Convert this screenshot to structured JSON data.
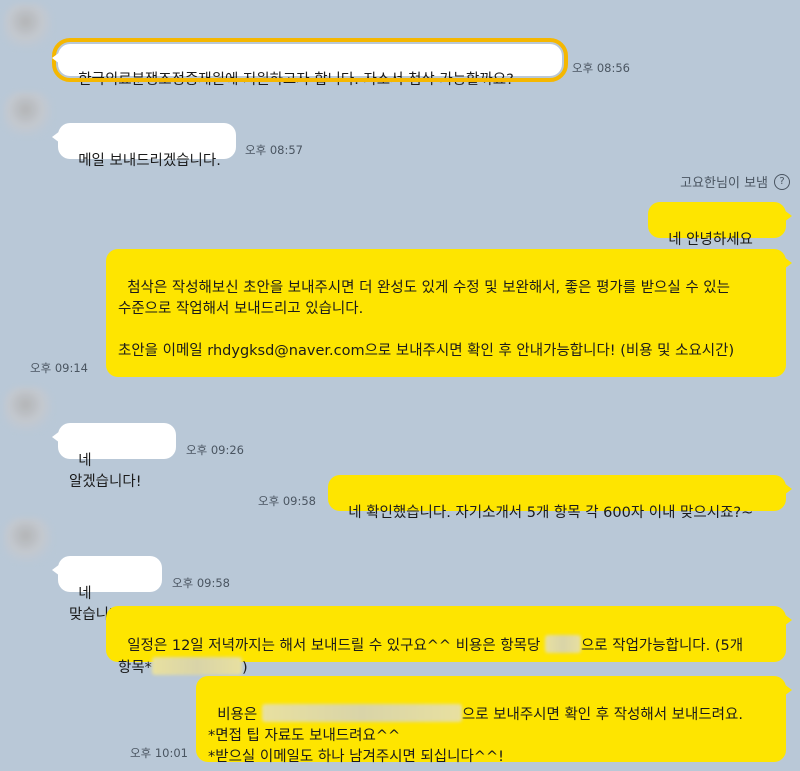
{
  "chat": {
    "m1": {
      "text": "한국의료분쟁조정중재원에 지원하고자 합니다. 자소서 첨삭 가능할까요?",
      "time": "오후 08:56"
    },
    "m2": {
      "text": "메일 보내드리겠습니다.",
      "time": "오후 08:57"
    },
    "sender_note": "고요한님이 보냄",
    "m3": {
      "text": "네 안녕하세요^^"
    },
    "m4": {
      "text": "첨삭은 작성해보신 초안을 보내주시면 더 완성도 있게 수정 및 보완해서, 좋은 평가를 받으실 수 있는 수준으로 작업해서 보내드리고 있습니다.\n\n초안을 이메일 rhdygksd@naver.com으로 보내주시면 확인 후 안내가능합니다! (비용 및 소요시간)",
      "time": "오후 09:14"
    },
    "m5": {
      "text": "네 알겠습니다!",
      "time": "오후 09:26"
    },
    "m6": {
      "text": "네 확인했습니다. 자기소개서 5개 항목 각 600자 이내 맞으시죠?~",
      "time": "오후 09:58"
    },
    "m7": {
      "text": "네 맞습니다!",
      "time": "오후 09:58"
    },
    "m8": {
      "part1": "일정은 12일 저녁까지는 해서 보내드릴 수 있구요^^ 비용은 항목당 ",
      "part2": "으로 작업가능합니다. (5개 항목*",
      "part3": ")"
    },
    "m9": {
      "part1": "비용은 ",
      "part2": "으로 보내주시면 확인 후 작성해서 보내드려요.\n*면접 팁 자료도 보내드려요^^\n*받으실 이메일도 하나 남겨주시면 되십니다^^!",
      "time": "오후 10:01"
    }
  },
  "colors": {
    "background": "#b9c8d7",
    "my_bubble": "#fee500",
    "their_bubble": "#ffffff",
    "highlight": "#f5b700"
  }
}
